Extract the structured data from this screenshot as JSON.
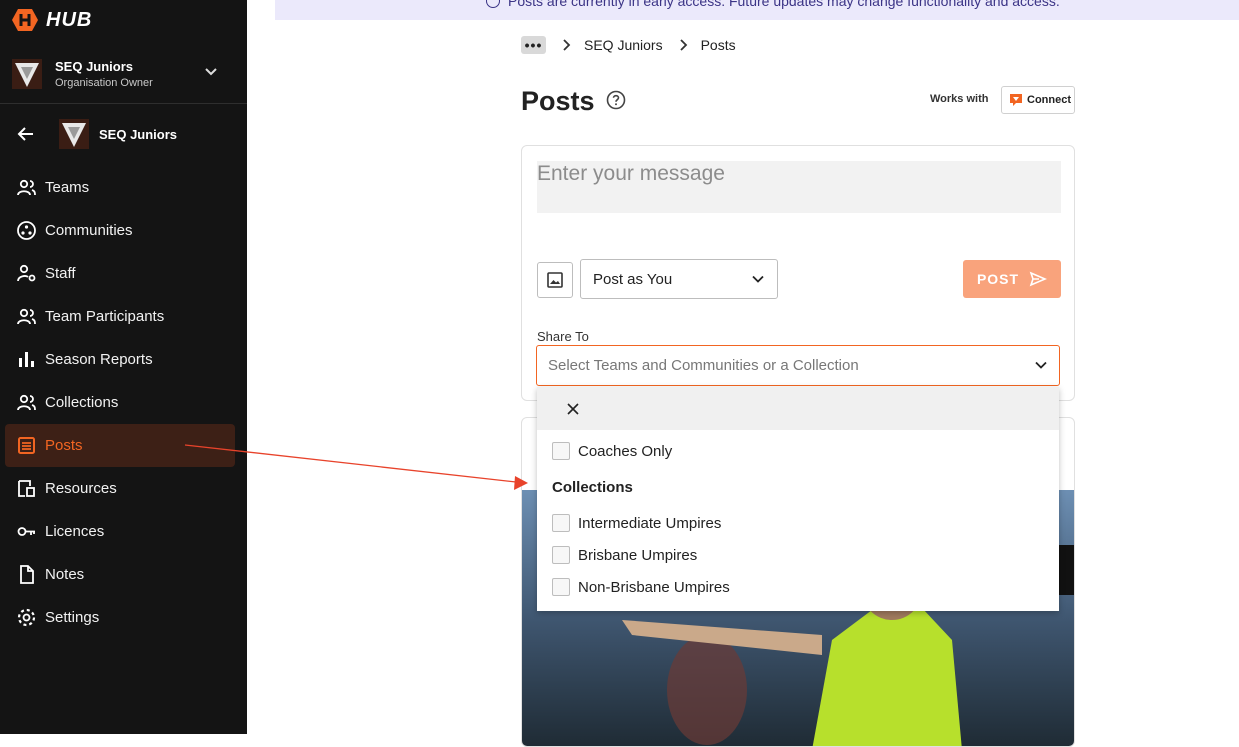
{
  "app": {
    "logo_text": "HUB"
  },
  "org_switcher": {
    "name": "SEQ Juniors",
    "role": "Organisation Owner"
  },
  "sub_header": {
    "name": "SEQ Juniors"
  },
  "nav": {
    "items": [
      {
        "label": "Teams",
        "icon": "people-icon"
      },
      {
        "label": "Communities",
        "icon": "communities-icon"
      },
      {
        "label": "Staff",
        "icon": "staff-icon"
      },
      {
        "label": "Team Participants",
        "icon": "people-icon"
      },
      {
        "label": "Season Reports",
        "icon": "bar-chart-icon"
      },
      {
        "label": "Collections",
        "icon": "people-icon"
      },
      {
        "label": "Posts",
        "icon": "posts-icon",
        "active": true
      },
      {
        "label": "Resources",
        "icon": "resources-icon"
      },
      {
        "label": "Licences",
        "icon": "key-icon"
      },
      {
        "label": "Notes",
        "icon": "document-icon"
      },
      {
        "label": "Settings",
        "icon": "gear-icon"
      }
    ]
  },
  "banner": {
    "text": "Posts are currently in early access. Future updates may change functionality and access."
  },
  "breadcrumb": {
    "more": "•••",
    "items": [
      "SEQ Juniors",
      "Posts"
    ]
  },
  "page": {
    "title": "Posts",
    "works_with": "Works with",
    "connect_label": "Connect"
  },
  "composer": {
    "message_placeholder": "Enter your message",
    "post_as": "Post as You",
    "post_button": "POST",
    "share_label": "Share To",
    "share_placeholder": "Select Teams and Communities or a Collection"
  },
  "dropdown": {
    "top_options": [
      "Coaches Only"
    ],
    "group_label": "Collections",
    "collections": [
      "Intermediate Umpires",
      "Brisbane Umpires",
      "Non-Brisbane Umpires"
    ]
  },
  "colors": {
    "accent": "#f26522",
    "sidebar_bg": "#141414",
    "post_button": "#f9a37c",
    "banner_bg": "#ebe9fb"
  }
}
